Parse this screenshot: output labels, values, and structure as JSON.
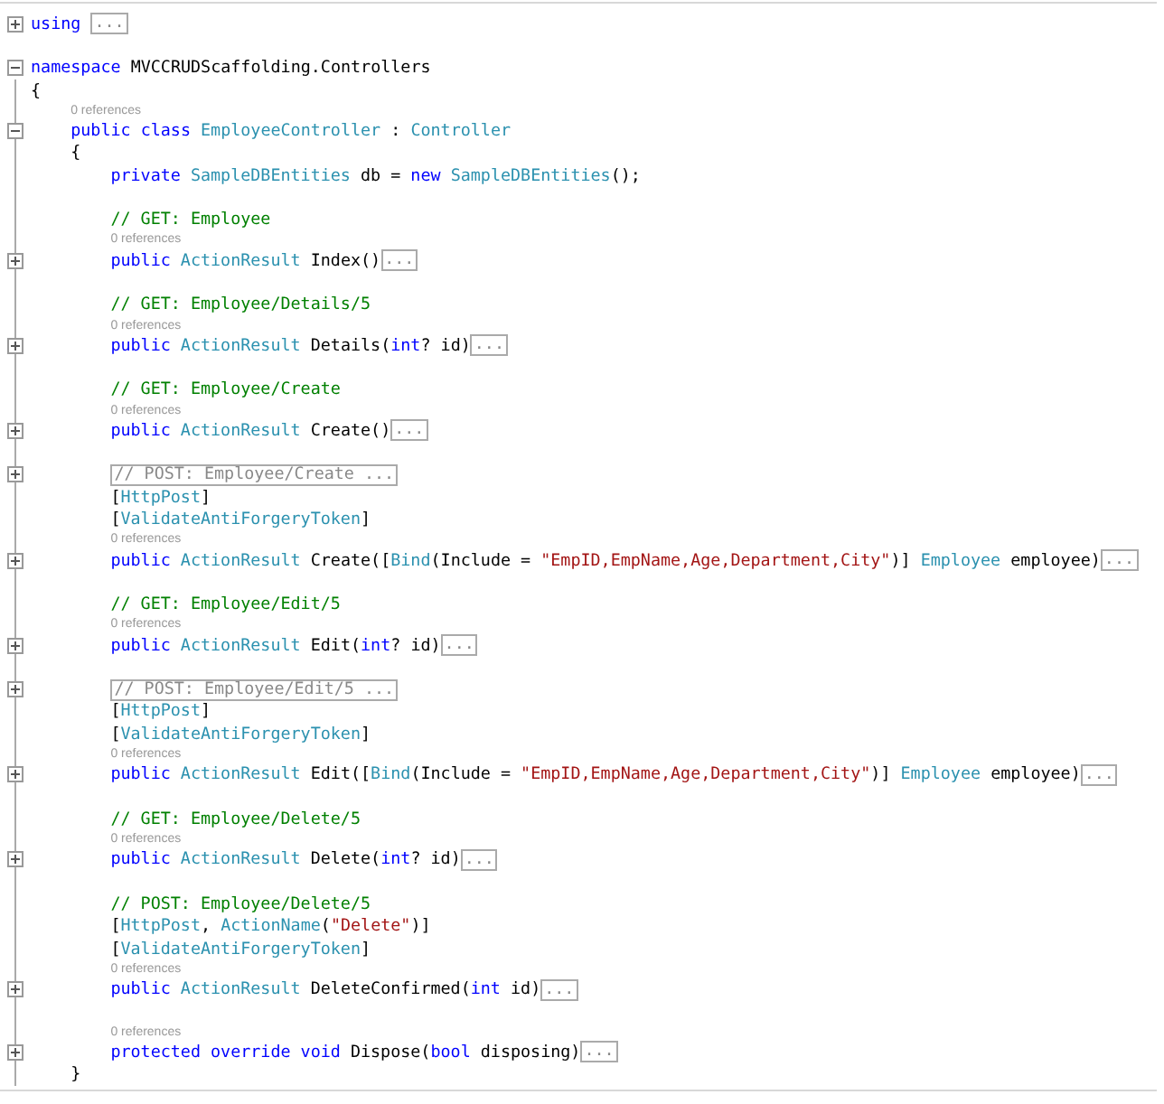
{
  "code": [
    {
      "kind": "code",
      "expanded": false,
      "tokens": [
        {
          "kind": "keyword",
          "text": "using "
        },
        {
          "kind": "box",
          "text": "..."
        }
      ]
    },
    {
      "kind": "blank"
    },
    {
      "kind": "code",
      "expanded": true,
      "tokens": [
        {
          "kind": "keyword",
          "text": "namespace"
        },
        {
          "kind": "plain",
          "text": " MVCCRUDScaffolding.Controllers"
        }
      ],
      "children": [
        {
          "kind": "brace",
          "text": "{"
        },
        {
          "kind": "lens",
          "text": "0 references"
        },
        {
          "kind": "code",
          "expanded": true,
          "tokens": [
            {
              "kind": "keyword",
              "text": "public class "
            },
            {
              "kind": "type",
              "text": "EmployeeController"
            },
            {
              "kind": "plain",
              "text": " : "
            },
            {
              "kind": "type",
              "text": "Controller"
            }
          ],
          "children": [
            {
              "kind": "brace",
              "text": "{"
            },
            {
              "kind": "code",
              "tokens": [
                {
                  "kind": "keyword",
                  "text": "private "
                },
                {
                  "kind": "type",
                  "text": "SampleDBEntities"
                },
                {
                  "kind": "plain",
                  "text": " db = "
                },
                {
                  "kind": "keyword",
                  "text": "new "
                },
                {
                  "kind": "type",
                  "text": "SampleDBEntities"
                },
                {
                  "kind": "plain",
                  "text": "();"
                }
              ]
            },
            {
              "kind": "blank"
            },
            {
              "kind": "code",
              "tokens": [
                {
                  "kind": "comment",
                  "text": "// GET: Employee"
                }
              ]
            },
            {
              "kind": "lens",
              "text": "0 references"
            },
            {
              "kind": "code",
              "expanded": false,
              "tokens": [
                {
                  "kind": "keyword",
                  "text": "public "
                },
                {
                  "kind": "type",
                  "text": "ActionResult"
                },
                {
                  "kind": "plain",
                  "text": " Index()"
                },
                {
                  "kind": "box",
                  "text": "..."
                }
              ]
            },
            {
              "kind": "blank"
            },
            {
              "kind": "code",
              "tokens": [
                {
                  "kind": "comment",
                  "text": "// GET: Employee/Details/5"
                }
              ]
            },
            {
              "kind": "lens",
              "text": "0 references"
            },
            {
              "kind": "code",
              "expanded": false,
              "tokens": [
                {
                  "kind": "keyword",
                  "text": "public "
                },
                {
                  "kind": "type",
                  "text": "ActionResult"
                },
                {
                  "kind": "plain",
                  "text": " Details("
                },
                {
                  "kind": "keyword",
                  "text": "int"
                },
                {
                  "kind": "plain",
                  "text": "? id)"
                },
                {
                  "kind": "box",
                  "text": "..."
                }
              ]
            },
            {
              "kind": "blank"
            },
            {
              "kind": "code",
              "tokens": [
                {
                  "kind": "comment",
                  "text": "// GET: Employee/Create"
                }
              ]
            },
            {
              "kind": "lens",
              "text": "0 references"
            },
            {
              "kind": "code",
              "expanded": false,
              "tokens": [
                {
                  "kind": "keyword",
                  "text": "public "
                },
                {
                  "kind": "type",
                  "text": "ActionResult"
                },
                {
                  "kind": "plain",
                  "text": " Create()"
                },
                {
                  "kind": "box",
                  "text": "..."
                }
              ]
            },
            {
              "kind": "blank"
            },
            {
              "kind": "code",
              "expanded": false,
              "tokens": [
                {
                  "kind": "box",
                  "text": "// POST: Employee/Create ..."
                }
              ]
            },
            {
              "kind": "code",
              "tokens": [
                {
                  "kind": "plain",
                  "text": "["
                },
                {
                  "kind": "type",
                  "text": "HttpPost"
                },
                {
                  "kind": "plain",
                  "text": "]"
                }
              ]
            },
            {
              "kind": "code",
              "tokens": [
                {
                  "kind": "plain",
                  "text": "["
                },
                {
                  "kind": "type",
                  "text": "ValidateAntiForgeryToken"
                },
                {
                  "kind": "plain",
                  "text": "]"
                }
              ]
            },
            {
              "kind": "lens",
              "text": "0 references"
            },
            {
              "kind": "code",
              "expanded": false,
              "tokens": [
                {
                  "kind": "keyword",
                  "text": "public "
                },
                {
                  "kind": "type",
                  "text": "ActionResult"
                },
                {
                  "kind": "plain",
                  "text": " Create(["
                },
                {
                  "kind": "type",
                  "text": "Bind"
                },
                {
                  "kind": "plain",
                  "text": "(Include = "
                },
                {
                  "kind": "string",
                  "text": "\"EmpID,EmpName,Age,Department,City\""
                },
                {
                  "kind": "plain",
                  "text": ")] "
                },
                {
                  "kind": "type",
                  "text": "Employee"
                },
                {
                  "kind": "plain",
                  "text": " employee)"
                },
                {
                  "kind": "box",
                  "text": "..."
                }
              ]
            },
            {
              "kind": "blank"
            },
            {
              "kind": "code",
              "tokens": [
                {
                  "kind": "comment",
                  "text": "// GET: Employee/Edit/5"
                }
              ]
            },
            {
              "kind": "lens",
              "text": "0 references"
            },
            {
              "kind": "code",
              "expanded": false,
              "tokens": [
                {
                  "kind": "keyword",
                  "text": "public "
                },
                {
                  "kind": "type",
                  "text": "ActionResult"
                },
                {
                  "kind": "plain",
                  "text": " Edit("
                },
                {
                  "kind": "keyword",
                  "text": "int"
                },
                {
                  "kind": "plain",
                  "text": "? id)"
                },
                {
                  "kind": "box",
                  "text": "..."
                }
              ]
            },
            {
              "kind": "blank"
            },
            {
              "kind": "code",
              "expanded": false,
              "tokens": [
                {
                  "kind": "box",
                  "text": "// POST: Employee/Edit/5 ..."
                }
              ]
            },
            {
              "kind": "code",
              "tokens": [
                {
                  "kind": "plain",
                  "text": "["
                },
                {
                  "kind": "type",
                  "text": "HttpPost"
                },
                {
                  "kind": "plain",
                  "text": "]"
                }
              ]
            },
            {
              "kind": "code",
              "tokens": [
                {
                  "kind": "plain",
                  "text": "["
                },
                {
                  "kind": "type",
                  "text": "ValidateAntiForgeryToken"
                },
                {
                  "kind": "plain",
                  "text": "]"
                }
              ]
            },
            {
              "kind": "lens",
              "text": "0 references"
            },
            {
              "kind": "code",
              "expanded": false,
              "tokens": [
                {
                  "kind": "keyword",
                  "text": "public "
                },
                {
                  "kind": "type",
                  "text": "ActionResult"
                },
                {
                  "kind": "plain",
                  "text": " Edit(["
                },
                {
                  "kind": "type",
                  "text": "Bind"
                },
                {
                  "kind": "plain",
                  "text": "(Include = "
                },
                {
                  "kind": "string",
                  "text": "\"EmpID,EmpName,Age,Department,City\""
                },
                {
                  "kind": "plain",
                  "text": ")] "
                },
                {
                  "kind": "type",
                  "text": "Employee"
                },
                {
                  "kind": "plain",
                  "text": " employee)"
                },
                {
                  "kind": "box",
                  "text": "..."
                }
              ]
            },
            {
              "kind": "blank"
            },
            {
              "kind": "code",
              "tokens": [
                {
                  "kind": "comment",
                  "text": "// GET: Employee/Delete/5"
                }
              ]
            },
            {
              "kind": "lens",
              "text": "0 references"
            },
            {
              "kind": "code",
              "expanded": false,
              "tokens": [
                {
                  "kind": "keyword",
                  "text": "public "
                },
                {
                  "kind": "type",
                  "text": "ActionResult"
                },
                {
                  "kind": "plain",
                  "text": " Delete("
                },
                {
                  "kind": "keyword",
                  "text": "int"
                },
                {
                  "kind": "plain",
                  "text": "? id)"
                },
                {
                  "kind": "box",
                  "text": "..."
                }
              ]
            },
            {
              "kind": "blank"
            },
            {
              "kind": "code",
              "tokens": [
                {
                  "kind": "comment",
                  "text": "// POST: Employee/Delete/5"
                }
              ]
            },
            {
              "kind": "code",
              "tokens": [
                {
                  "kind": "plain",
                  "text": "["
                },
                {
                  "kind": "type",
                  "text": "HttpPost"
                },
                {
                  "kind": "plain",
                  "text": ", "
                },
                {
                  "kind": "type",
                  "text": "ActionName"
                },
                {
                  "kind": "plain",
                  "text": "("
                },
                {
                  "kind": "string",
                  "text": "\"Delete\""
                },
                {
                  "kind": "plain",
                  "text": ")]"
                }
              ]
            },
            {
              "kind": "code",
              "tokens": [
                {
                  "kind": "plain",
                  "text": "["
                },
                {
                  "kind": "type",
                  "text": "ValidateAntiForgeryToken"
                },
                {
                  "kind": "plain",
                  "text": "]"
                }
              ]
            },
            {
              "kind": "lens",
              "text": "0 references"
            },
            {
              "kind": "code",
              "expanded": false,
              "tokens": [
                {
                  "kind": "keyword",
                  "text": "public "
                },
                {
                  "kind": "type",
                  "text": "ActionResult"
                },
                {
                  "kind": "plain",
                  "text": " DeleteConfirmed("
                },
                {
                  "kind": "keyword",
                  "text": "int"
                },
                {
                  "kind": "plain",
                  "text": " id)"
                },
                {
                  "kind": "box",
                  "text": "..."
                }
              ]
            },
            {
              "kind": "blank"
            },
            {
              "kind": "lens",
              "text": "0 references"
            },
            {
              "kind": "code",
              "expanded": false,
              "tokens": [
                {
                  "kind": "keyword",
                  "text": "protected override void "
                },
                {
                  "kind": "plain",
                  "text": "Dispose("
                },
                {
                  "kind": "keyword",
                  "text": "bool"
                },
                {
                  "kind": "plain",
                  "text": " disposing)"
                },
                {
                  "kind": "box",
                  "text": "..."
                }
              ]
            },
            {
              "kind": "brace",
              "text": "}"
            }
          ]
        }
      ]
    }
  ]
}
